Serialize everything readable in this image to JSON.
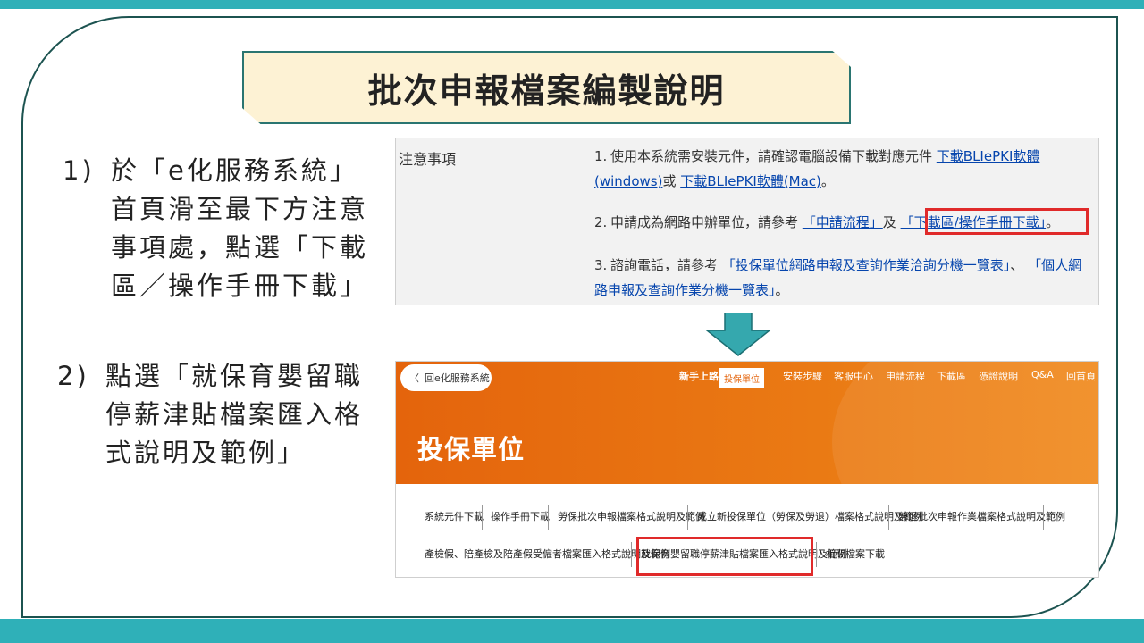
{
  "slide": {
    "title": "批次申報檔案編製說明",
    "steps": [
      {
        "num": "1)",
        "text": "於「e化服務系統」\n首頁滑至最下方注意\n事項處，點選「下載\n區／操作手冊下載」"
      },
      {
        "num": "2)",
        "text": "點選「就保育嬰留職\n停薪津貼檔案匯入格\n式說明及範例」"
      }
    ]
  },
  "notice": {
    "label": "注意事項",
    "items": [
      {
        "num": "1.",
        "pre": "使用本系統需安裝元件，請確認電腦設備下載對應元件 ",
        "link1": "下載BLIePKI軟體(windows)",
        "mid": "或 ",
        "link2": "下載BLIePKI軟體(Mac)",
        "post": "。"
      },
      {
        "num": "2.",
        "pre": "申請成為網路申辦單位，請參考 ",
        "link1": "「申請流程」",
        "mid": "及 ",
        "link2": "「下載區/操作手冊下載」",
        "post": "。"
      },
      {
        "num": "3.",
        "pre": "諮詢電話，請參考 ",
        "link1": "「投保單位網路申報及查詢作業洽詢分機一覽表」",
        "mid": "、 ",
        "link2": "「個人網路申報及查詢作業分機一覽表」",
        "post": "。"
      }
    ]
  },
  "site": {
    "back_label": "回e化服務系統",
    "nav": {
      "newbie": "新手上路",
      "badge": "投保單位",
      "items": [
        "安裝步驟",
        "客服中心",
        "申請流程",
        "下載區",
        "憑證說明",
        "Q&A",
        "回首頁"
      ]
    },
    "hero_title": "投保單位",
    "links_row1": [
      "系統元件下載",
      "操作手冊下載",
      "勞保批次申報檔案格式說明及範例",
      "成立新投保單位（勞保及勞退）檔案格式說明及範例",
      "勞退批次申報作業檔案格式說明及範例"
    ],
    "links_row2": [
      "產檢假、陪產檢及陪產假受僱者檔案匯入格式說明及範例",
      "就保育嬰留職停薪津貼檔案匯入格式說明及範例",
      "相關檔案下載"
    ]
  },
  "colors": {
    "band": "#2fb0b8",
    "frame": "#1c5350",
    "title_bg": "#fdf2d4",
    "highlight": "#e02a2a",
    "site_orange": "#e4640c"
  }
}
